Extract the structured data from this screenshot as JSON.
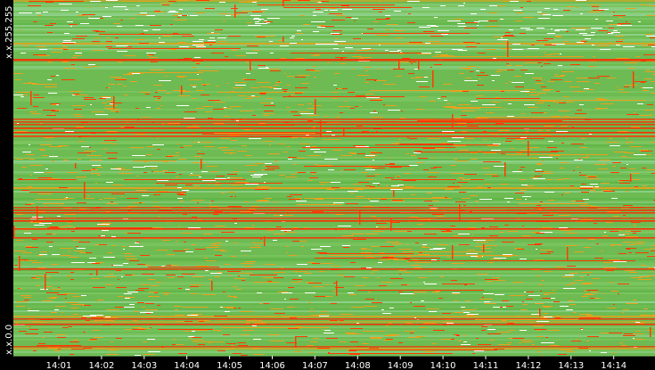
{
  "chart_data": {
    "type": "heatmap",
    "title": "",
    "xlabel": "",
    "ylabel": "",
    "x_ticks": [
      "14:01",
      "14:02",
      "14:03",
      "14:04",
      "14:05",
      "14:06",
      "14:07",
      "14:08",
      "14:09",
      "14:10",
      "14:11",
      "14:12",
      "14:13",
      "14:14"
    ],
    "y_ticks": [
      "x.x.255.255",
      "x.x.0.0"
    ],
    "x_range": [
      "14:00:40",
      "14:14:52"
    ],
    "color_scale": [
      "#ffffff",
      "#8fd18a",
      "#5fb548",
      "#e8a21c",
      "#ff3b00"
    ],
    "background": "#000000",
    "grid": false,
    "dominant_color": "#6dbb52",
    "hot_row_color": "#ff2a00"
  }
}
